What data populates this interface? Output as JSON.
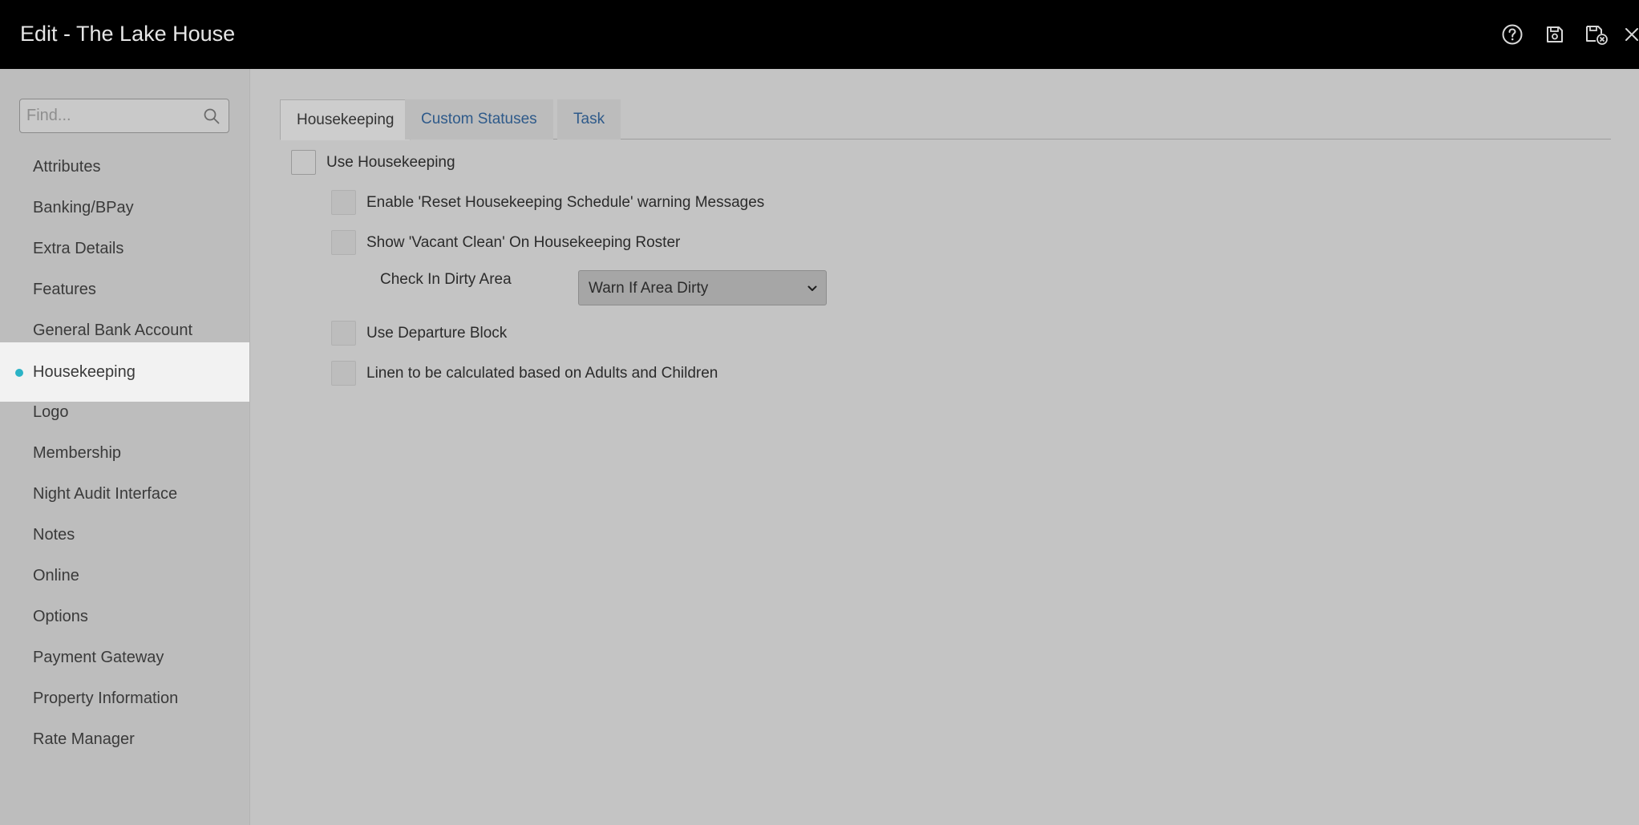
{
  "header": {
    "title": "Edit - The Lake House",
    "icons": [
      "help-icon",
      "save-icon",
      "save-close-icon",
      "close-icon"
    ]
  },
  "sidebar": {
    "search_placeholder": "Find...",
    "items": [
      {
        "label": "Attributes"
      },
      {
        "label": "Banking/BPay"
      },
      {
        "label": "Extra Details"
      },
      {
        "label": "Features"
      },
      {
        "label": "General Bank Account"
      },
      {
        "label": "Housekeeping",
        "active": true
      },
      {
        "label": "Logo"
      },
      {
        "label": "Membership"
      },
      {
        "label": "Night Audit Interface"
      },
      {
        "label": "Notes"
      },
      {
        "label": "Online"
      },
      {
        "label": "Options"
      },
      {
        "label": "Payment Gateway"
      },
      {
        "label": "Property Information"
      },
      {
        "label": "Rate Manager"
      }
    ]
  },
  "tabs": [
    {
      "label": "Housekeeping",
      "active": true
    },
    {
      "label": "Custom Statuses",
      "active": false
    },
    {
      "label": "Task",
      "active": false
    }
  ],
  "options": {
    "use_housekeeping": {
      "label": "Use Housekeeping",
      "checked": false
    },
    "enable_reset_warning": {
      "label": "Enable 'Reset Housekeeping Schedule' warning Messages",
      "checked": false
    },
    "show_vacant_clean": {
      "label": "Show 'Vacant Clean' On Housekeeping Roster",
      "checked": false
    },
    "check_in_dirty_area": {
      "label": "Check In Dirty Area",
      "value": "Warn If Area Dirty"
    },
    "use_departure_block": {
      "label": "Use Departure Block",
      "checked": false
    },
    "linen_calculation": {
      "label": "Linen to be calculated based on Adults and Children",
      "checked": false
    }
  },
  "colors": {
    "header_bg": "#000000",
    "active_dot": "#2bb3c6",
    "tab_link": "#2e5a8a",
    "overlay_bg": "#c4c4c4"
  }
}
